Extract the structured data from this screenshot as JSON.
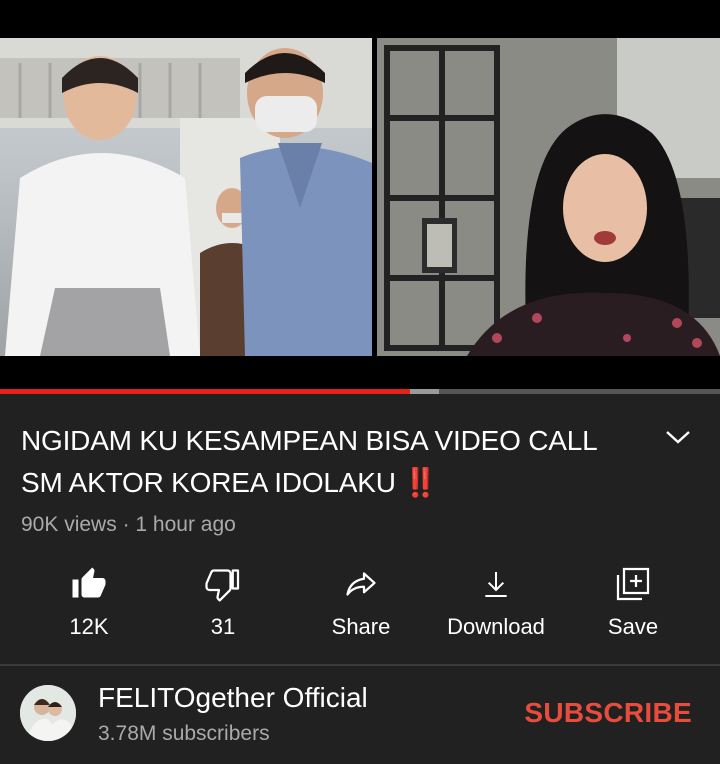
{
  "video": {
    "progress": 0.57,
    "buffered": 0.61
  },
  "title": {
    "text": "NGIDAM KU KESAMPEAN BISA VIDEO CALL SM AKTOR KOREA IDOLAKU",
    "emoji": "‼️"
  },
  "meta": {
    "views": "90K views",
    "separator": "·",
    "age": "1 hour ago"
  },
  "actions": {
    "like": {
      "label": "12K",
      "icon": "thumb-up-icon"
    },
    "dislike": {
      "label": "31",
      "icon": "thumb-down-icon"
    },
    "share": {
      "label": "Share",
      "icon": "share-icon"
    },
    "download": {
      "label": "Download",
      "icon": "download-icon"
    },
    "save": {
      "label": "Save",
      "icon": "add-to-playlist-icon"
    }
  },
  "channel": {
    "name": "FELITOgether Official",
    "subscribers": "3.78M subscribers",
    "subscribe_label": "SUBSCRIBE"
  },
  "colors": {
    "background": "#212121",
    "progress": "#e62117",
    "subscribe": "#e84c3d",
    "secondary_text": "#aaaaaa"
  }
}
